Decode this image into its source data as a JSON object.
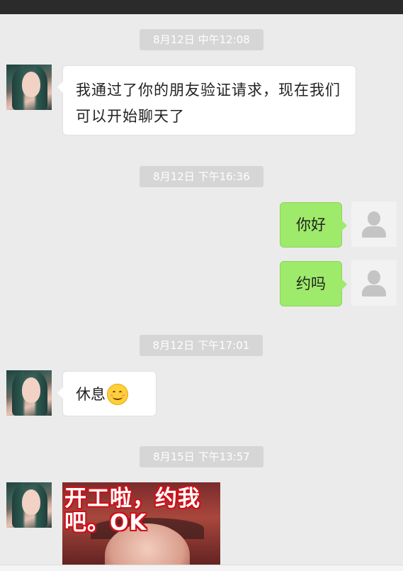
{
  "messages": [
    {
      "timestamp": "8月12日  中午12:08",
      "text": "我通过了你的朋友验证请求，现在我们可以开始聊天了"
    },
    {
      "timestamp": "8月12日  下午16:36",
      "text_1": "你好",
      "text_2": "约吗"
    },
    {
      "timestamp": "8月12日  下午17:01",
      "text": "休息",
      "emoji": "smile-emoji"
    },
    {
      "timestamp": "8月15日  下午13:57",
      "image_caption_line1": "开工啦，约我",
      "image_caption_line2": "吧。OK"
    }
  ],
  "icons": {
    "contact_avatar": "contact-avatar-photo",
    "self_avatar": "default-user-avatar-icon"
  },
  "colors": {
    "background": "#ebebeb",
    "outgoing_bubble": "#9eea6a",
    "incoming_bubble": "#ffffff",
    "timestamp_pill": "#d6d6d6",
    "caption_outline": "#d0101a"
  }
}
